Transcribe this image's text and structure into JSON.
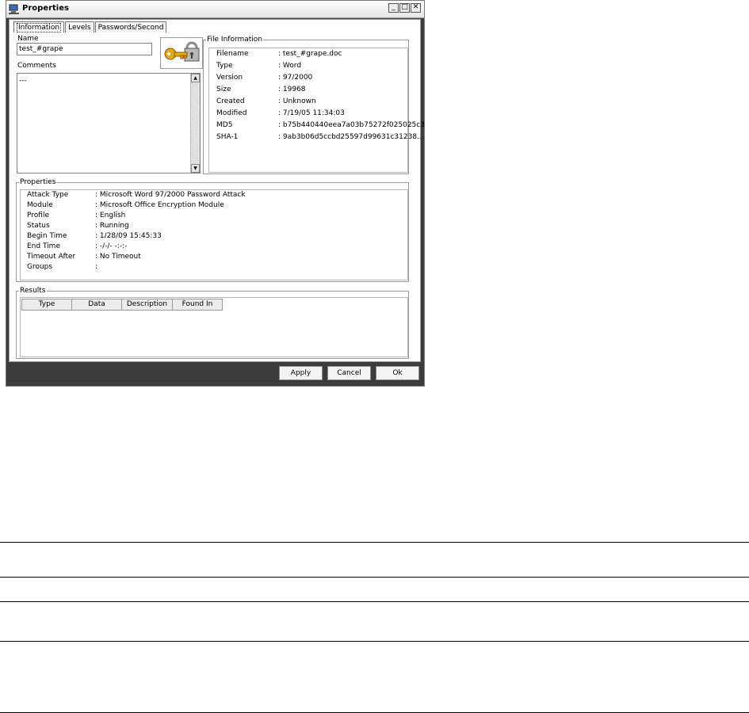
{
  "window": {
    "title": "Properties",
    "minimize": "_",
    "maximize": "□",
    "close": "✕"
  },
  "tabs": [
    {
      "label": "Information",
      "active": true
    },
    {
      "label": "Levels",
      "active": false
    },
    {
      "label": "Passwords/Second",
      "active": false
    }
  ],
  "name_label": "Name",
  "name_value": "test_#grape",
  "comments_label": "Comments",
  "comments_value": "---",
  "file_info": {
    "title": "File Information",
    "rows": [
      {
        "key": "Filename",
        "value": ": test_#grape.doc"
      },
      {
        "key": "Type",
        "value": ": Word"
      },
      {
        "key": "Version",
        "value": ": 97/2000"
      },
      {
        "key": "Size",
        "value": ": 19968"
      },
      {
        "key": "Created",
        "value": ": Unknown"
      },
      {
        "key": "Modified",
        "value": ": 7/19/05 11:34:03"
      },
      {
        "key": "MD5",
        "value": ": b75b440440eea7a03b75272f025025c3"
      },
      {
        "key": "SHA-1",
        "value": ": 9ab3b06d5ccbd25597d99631c31238..."
      }
    ]
  },
  "properties": {
    "title": "Properties",
    "rows": [
      {
        "key": "Attack Type",
        "value": ": Microsoft Word 97/2000 Password Attack"
      },
      {
        "key": "Module",
        "value": ": Microsoft Office Encryption Module"
      },
      {
        "key": "Profile",
        "value": ": English"
      },
      {
        "key": "Status",
        "value": ": Running"
      },
      {
        "key": "Begin Time",
        "value": ": 1/28/09 15:45:33"
      },
      {
        "key": "End Time",
        "value": ": -/-/- -:-:-"
      },
      {
        "key": "Timeout After",
        "value": ": No Timeout"
      },
      {
        "key": "Groups",
        "value": ":"
      }
    ]
  },
  "results": {
    "title": "Results",
    "columns": [
      "Type",
      "Data",
      "Description",
      "Found In"
    ]
  },
  "buttons": {
    "apply": "Apply",
    "cancel": "Cancel",
    "ok": "Ok"
  },
  "colors": {
    "key_gold": "#e3a812",
    "lock_gray": "#9a9a9a",
    "frame_dark": "#3c3c3c"
  }
}
